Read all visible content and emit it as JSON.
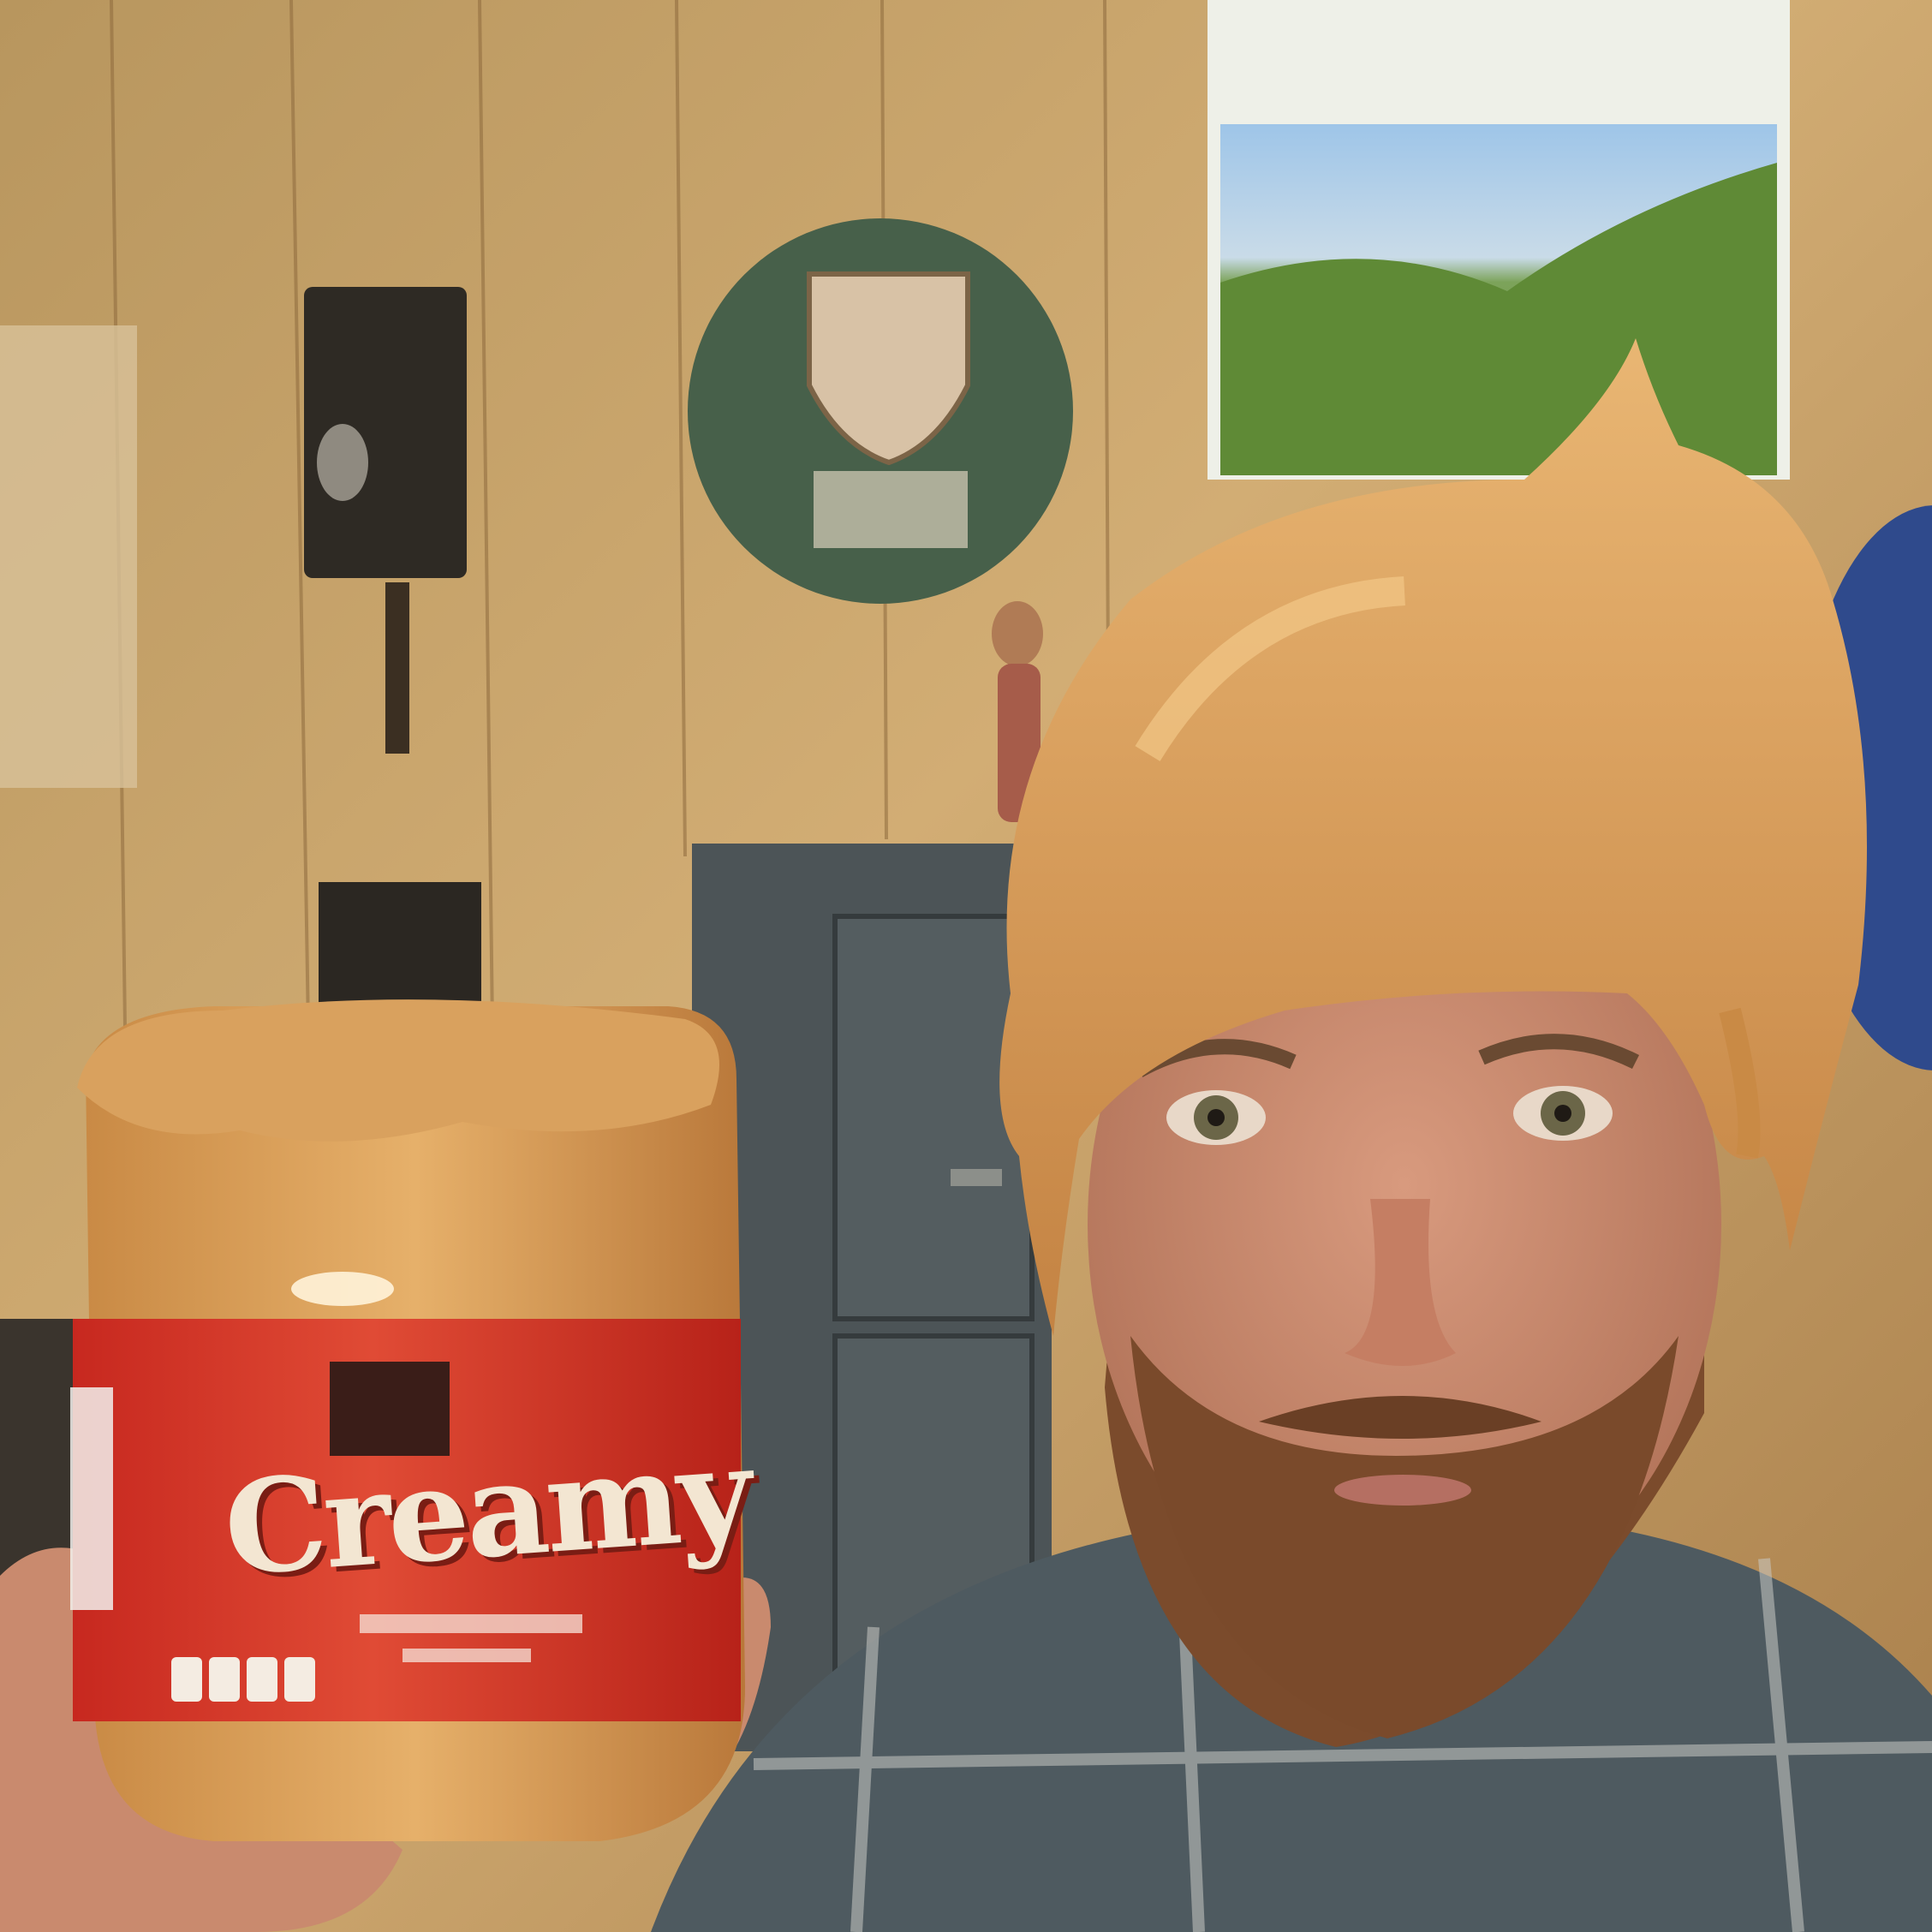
{
  "photo": {
    "label_text": "Creamy",
    "palette": {
      "wall": "#caa36a",
      "wall_dark": "#9c7544",
      "peanut_butter": "#d9a15e",
      "label_red": "#d63a2c",
      "plaque_green": "#47604a",
      "cabinet": "#4c5457",
      "shirt": "#4e5a60",
      "skin": "#c98a6e",
      "beard": "#7b4b2c",
      "blue_object": "#2f4a8c"
    }
  }
}
